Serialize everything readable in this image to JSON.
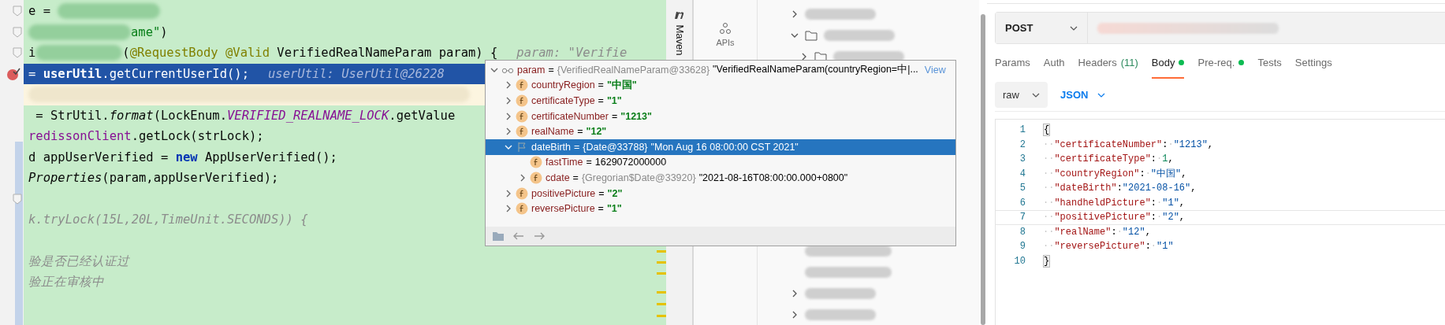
{
  "editor": {
    "lines": [
      {
        "kind": "normal",
        "fold": true,
        "segments": [
          {
            "kind": "plain",
            "text": "e = "
          },
          {
            "kind": "redacted"
          }
        ]
      },
      {
        "kind": "normal",
        "fold": true,
        "segments": [
          {
            "kind": "redacted"
          },
          {
            "kind": "string",
            "text": "ame\""
          },
          {
            "kind": "plain",
            "text": ")"
          }
        ]
      },
      {
        "kind": "normal",
        "fold": true,
        "segments": [
          {
            "kind": "plain",
            "text": "i"
          },
          {
            "kind": "redacted"
          },
          {
            "kind": "plain",
            "text": "("
          },
          {
            "kind": "annotation",
            "text": "@RequestBody @Valid"
          },
          {
            "kind": "plain",
            "text": " VerifiedRealNameParam param) {"
          },
          {
            "kind": "hint",
            "text": "param: \"Verifie"
          }
        ]
      },
      {
        "kind": "execution",
        "fold": false,
        "segments": [
          {
            "kind": "plain",
            "text": "= "
          },
          {
            "kind": "bold",
            "text": "userUtil"
          },
          {
            "kind": "plain",
            "text": ".getCurrentUserId();"
          },
          {
            "kind": "hint",
            "text": "userUtil: UserUtil@26228"
          }
        ]
      },
      {
        "kind": "caret",
        "fold": false,
        "segments": [
          {
            "kind": "redacted"
          }
        ]
      },
      {
        "kind": "normal",
        "fold": false,
        "segments": [
          {
            "kind": "plain",
            "text": " = StrUtil."
          },
          {
            "kind": "static",
            "text": "format"
          },
          {
            "kind": "plain",
            "text": "(LockEnum."
          },
          {
            "kind": "constant",
            "text": "VERIFIED_REALNAME_LOCK"
          },
          {
            "kind": "plain",
            "text": ".getValue"
          }
        ]
      },
      {
        "kind": "normal",
        "fold": false,
        "segments": [
          {
            "kind": "field",
            "text": "redissonClient"
          },
          {
            "kind": "plain",
            "text": ".getLock(strLock);"
          }
        ]
      },
      {
        "kind": "normal",
        "fold": false,
        "segments": [
          {
            "kind": "plain",
            "text": "d appUserVerified = "
          },
          {
            "kind": "keyword",
            "text": "new"
          },
          {
            "kind": "plain",
            "text": " AppUserVerified();"
          }
        ]
      },
      {
        "kind": "normal",
        "fold": false,
        "segments": [
          {
            "kind": "static",
            "text": "Properties"
          },
          {
            "kind": "plain",
            "text": "(param,appUserVerified);"
          }
        ]
      },
      {
        "kind": "normal",
        "fold": true
      },
      {
        "kind": "normal",
        "fold": false,
        "segments": [
          {
            "kind": "dim",
            "text": "k.tryLock(15L,20L,TimeUnit.SECONDS)) {"
          }
        ]
      },
      {
        "kind": "normal"
      },
      {
        "kind": "normal",
        "fold": false,
        "segments": [
          {
            "kind": "comment",
            "text": "验是否已经认证过"
          }
        ]
      },
      {
        "kind": "normal",
        "fold": false,
        "segments": [
          {
            "kind": "comment",
            "text": "验正在审核中"
          }
        ]
      }
    ]
  },
  "debugger": {
    "tree": [
      {
        "kind": "object",
        "name": "param",
        "operator": "=",
        "type_ref": "{VerifiedRealNameParam@33628}",
        "value": "\"VerifiedRealNameParam(countryRegion=中|...",
        "literal": false,
        "expanded": true,
        "selected": false,
        "link": "View",
        "children": [
          {
            "kind": "field",
            "name": "countryRegion",
            "operator": "=",
            "value": "\"中国\"",
            "literal": true,
            "expanded": false,
            "selected": false
          },
          {
            "kind": "field",
            "name": "certificateType",
            "operator": "=",
            "value": "\"1\"",
            "literal": true,
            "expanded": false,
            "selected": false
          },
          {
            "kind": "field",
            "name": "certificateNumber",
            "operator": "=",
            "value": "\"1213\"",
            "literal": true,
            "expanded": false,
            "selected": false
          },
          {
            "kind": "field",
            "name": "realName",
            "operator": "=",
            "value": "\"12\"",
            "literal": true,
            "expanded": false,
            "selected": false
          },
          {
            "kind": "flag",
            "name": "dateBirth",
            "operator": "=",
            "type_ref": "{Date@33788}",
            "value": "\"Mon Aug 16 08:00:00 CST 2021\"",
            "literal": false,
            "expanded": true,
            "selected": true,
            "children": [
              {
                "kind": "field",
                "name": "fastTime",
                "operator": "=",
                "value": "1629072000000",
                "literal": false,
                "selected": false
              },
              {
                "kind": "field",
                "name": "cdate",
                "operator": "=",
                "type_ref": "{Gregorian$Date@33920}",
                "value": "\"2021-08-16T08:00:00.000+0800\"",
                "literal": false,
                "expanded": false,
                "selected": false
              }
            ]
          },
          {
            "kind": "field",
            "name": "positivePicture",
            "operator": "=",
            "value": "\"2\"",
            "literal": true,
            "expanded": false,
            "selected": false
          },
          {
            "kind": "field",
            "name": "reversePicture",
            "operator": "=",
            "value": "\"1\"",
            "literal": true,
            "expanded": false,
            "selected": false
          }
        ]
      }
    ]
  },
  "maven": {
    "label": "Maven"
  },
  "api_sidebar": {
    "label": "APIs"
  },
  "tree_head": [
    {
      "kind": "item",
      "expanded": false
    },
    {
      "kind": "folder",
      "expanded": true,
      "children": [
        {
          "kind": "folder",
          "expanded": false
        }
      ]
    }
  ],
  "tree_tail": [
    {
      "kind": "leaf"
    },
    {
      "kind": "leaf"
    },
    {
      "kind": "item",
      "expanded": false
    },
    {
      "kind": "item",
      "expanded": false
    }
  ],
  "request": {
    "method": "POST",
    "tabs": [
      {
        "label": "Params",
        "selected": false,
        "indicator": false
      },
      {
        "label": "Auth",
        "selected": false,
        "indicator": false
      },
      {
        "label": "Headers",
        "count": "(11)",
        "selected": false,
        "indicator": false
      },
      {
        "label": "Body",
        "selected": true,
        "indicator": true
      },
      {
        "label": "Pre-req.",
        "selected": false,
        "indicator": true
      },
      {
        "label": "Tests",
        "selected": false,
        "indicator": false
      },
      {
        "label": "Settings",
        "selected": false,
        "indicator": false
      }
    ],
    "body_mode": "raw",
    "language": "JSON",
    "body_lines": [
      {
        "number": "1",
        "selected": false,
        "segments": [
          {
            "kind": "bracket",
            "text": "{"
          }
        ]
      },
      {
        "number": "2",
        "selected": false,
        "segments": [
          {
            "kind": "ws",
            "text": "··"
          },
          {
            "kind": "key",
            "text": "\"certificateNumber\""
          },
          {
            "kind": "punct",
            "text": ":"
          },
          {
            "kind": "ws",
            "text": "·"
          },
          {
            "kind": "string",
            "text": "\"1213\""
          },
          {
            "kind": "punct",
            "text": ","
          }
        ]
      },
      {
        "number": "3",
        "selected": false,
        "segments": [
          {
            "kind": "ws",
            "text": "··"
          },
          {
            "kind": "key",
            "text": "\"certificateType\""
          },
          {
            "kind": "punct",
            "text": ":"
          },
          {
            "kind": "ws",
            "text": "·"
          },
          {
            "kind": "number",
            "text": "1"
          },
          {
            "kind": "punct",
            "text": ","
          }
        ]
      },
      {
        "number": "4",
        "selected": false,
        "segments": [
          {
            "kind": "ws",
            "text": "··"
          },
          {
            "kind": "key",
            "text": "\"countryRegion\""
          },
          {
            "kind": "punct",
            "text": ":"
          },
          {
            "kind": "ws",
            "text": "·"
          },
          {
            "kind": "string",
            "text": "\"中国\""
          },
          {
            "kind": "punct",
            "text": ","
          }
        ]
      },
      {
        "number": "5",
        "selected": false,
        "segments": [
          {
            "kind": "ws",
            "text": "··"
          },
          {
            "kind": "key",
            "text": "\"dateBirth\""
          },
          {
            "kind": "punct",
            "text": ":"
          },
          {
            "kind": "string",
            "text": "\"2021-08-16\""
          },
          {
            "kind": "punct",
            "text": ","
          }
        ]
      },
      {
        "number": "6",
        "selected": false,
        "segments": [
          {
            "kind": "ws",
            "text": "··"
          },
          {
            "kind": "key",
            "text": "\"handheldPicture\""
          },
          {
            "kind": "punct",
            "text": ":"
          },
          {
            "kind": "ws",
            "text": "·"
          },
          {
            "kind": "string",
            "text": "\"1\""
          },
          {
            "kind": "punct",
            "text": ","
          }
        ]
      },
      {
        "number": "7",
        "selected": true,
        "segments": [
          {
            "kind": "ws",
            "text": "··"
          },
          {
            "kind": "key",
            "text": "\"positivePicture\""
          },
          {
            "kind": "punct",
            "text": ":"
          },
          {
            "kind": "ws",
            "text": "·"
          },
          {
            "kind": "string",
            "text": "\"2\""
          },
          {
            "kind": "punct",
            "text": ","
          }
        ]
      },
      {
        "number": "8",
        "selected": false,
        "segments": [
          {
            "kind": "ws",
            "text": "··"
          },
          {
            "kind": "key",
            "text": "\"realName\""
          },
          {
            "kind": "punct",
            "text": ":"
          },
          {
            "kind": "ws",
            "text": "·"
          },
          {
            "kind": "string",
            "text": "\"12\""
          },
          {
            "kind": "punct",
            "text": ","
          }
        ]
      },
      {
        "number": "9",
        "selected": false,
        "segments": [
          {
            "kind": "ws",
            "text": "··"
          },
          {
            "kind": "key",
            "text": "\"reversePicture\""
          },
          {
            "kind": "punct",
            "text": ":"
          },
          {
            "kind": "ws",
            "text": "·"
          },
          {
            "kind": "string",
            "text": "\"1\""
          }
        ]
      },
      {
        "number": "10",
        "selected": false,
        "segments": [
          {
            "kind": "bracket",
            "text": "}"
          }
        ]
      }
    ]
  }
}
